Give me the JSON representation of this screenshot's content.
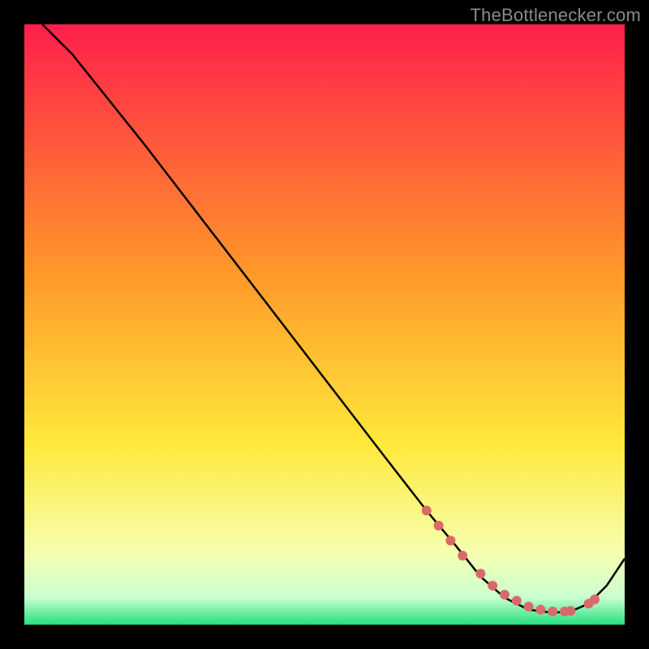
{
  "watermark": "TheBottlenecker.com",
  "colors": {
    "bg": "#000000",
    "curve": "#000000",
    "dot": "#d96a6a",
    "grad_top": "#ff1f4b",
    "grad_mid1": "#ff9a2a",
    "grad_mid2": "#ffe93b",
    "grad_low1": "#f6ffb0",
    "grad_low2": "#c9ffd0",
    "grad_bot": "#25e07f"
  },
  "chart_data": {
    "type": "line",
    "title": "",
    "xlabel": "",
    "ylabel": "",
    "xlim": [
      0,
      100
    ],
    "ylim": [
      0,
      100
    ],
    "series": [
      {
        "name": "curve",
        "x": [
          3,
          8,
          12,
          20,
          30,
          40,
          50,
          60,
          67,
          72,
          76,
          80,
          84,
          88,
          91,
          94,
          97,
          100
        ],
        "y": [
          100,
          95,
          90,
          80,
          67,
          54,
          41,
          28,
          19,
          13,
          8,
          4.5,
          2.5,
          2,
          2.2,
          3.5,
          6.5,
          11
        ]
      }
    ],
    "dots": {
      "name": "highlight-dots",
      "x": [
        67,
        69,
        71,
        73,
        76,
        78,
        80,
        82,
        84,
        86,
        88,
        90,
        91,
        94,
        95
      ],
      "y": [
        19,
        16.5,
        14,
        11.5,
        8.5,
        6.5,
        5,
        4,
        3,
        2.5,
        2.2,
        2.2,
        2.3,
        3.5,
        4.2
      ]
    }
  }
}
